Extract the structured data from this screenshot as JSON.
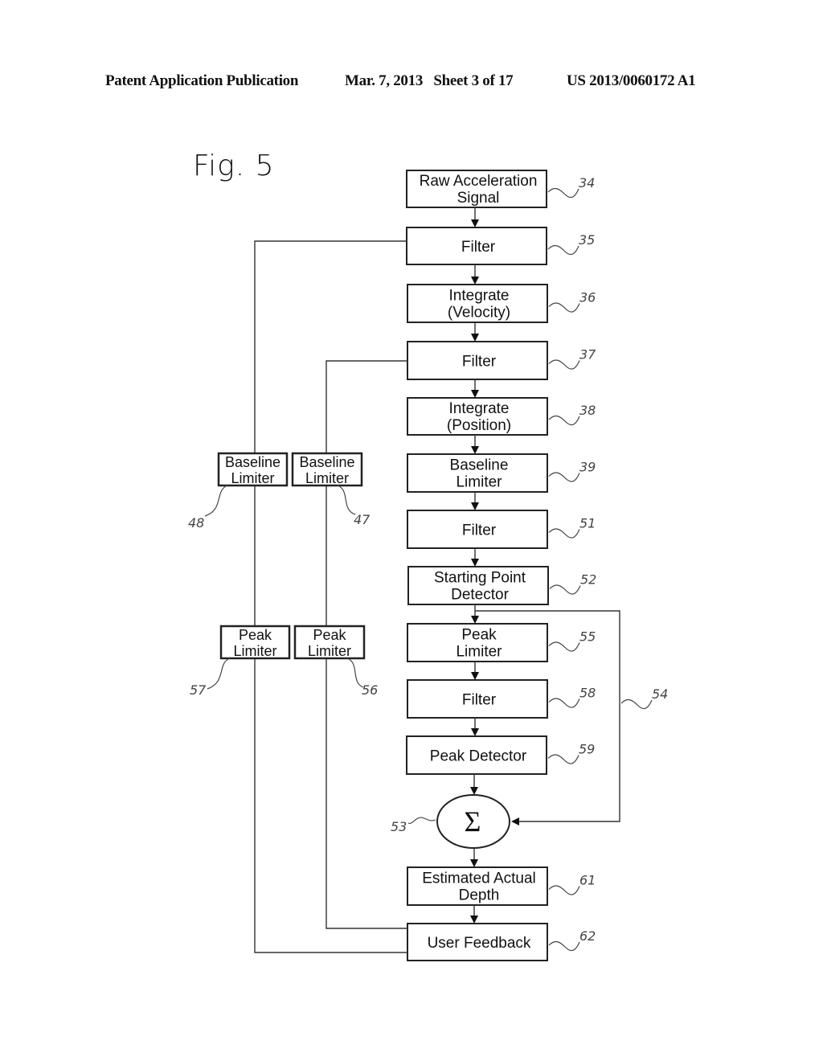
{
  "header": {
    "publication": "Patent Application Publication",
    "date_sheet": "Mar. 7, 2013   Sheet 3 of 17",
    "number": "US 2013/0060172 A1"
  },
  "figure": {
    "title": "Fig. 5",
    "main_blocks": [
      {
        "ref": "34",
        "lines": [
          "Raw Acceleration",
          "Signal"
        ]
      },
      {
        "ref": "35",
        "lines": [
          "Filter"
        ]
      },
      {
        "ref": "36",
        "lines": [
          "Integrate",
          "(Velocity)"
        ]
      },
      {
        "ref": "37",
        "lines": [
          "Filter"
        ]
      },
      {
        "ref": "38",
        "lines": [
          "Integrate",
          "(Position)"
        ]
      },
      {
        "ref": "39",
        "lines": [
          "Baseline",
          "Limiter"
        ]
      },
      {
        "ref": "51",
        "lines": [
          "Filter"
        ]
      },
      {
        "ref": "52",
        "lines": [
          "Starting Point",
          "Detector"
        ]
      },
      {
        "ref": "55",
        "lines": [
          "Peak",
          "Limiter"
        ]
      },
      {
        "ref": "58",
        "lines": [
          "Filter"
        ]
      },
      {
        "ref": "59",
        "lines": [
          "Peak Detector"
        ]
      },
      {
        "ref": "61",
        "lines": [
          "Estimated Actual",
          "Depth"
        ]
      },
      {
        "ref": "62",
        "lines": [
          "User Feedback"
        ]
      }
    ],
    "summer": {
      "ref": "53",
      "symbol": "Σ"
    },
    "bypass_ref": "54",
    "side_blocks": [
      {
        "ref": "48",
        "lines": [
          "Baseline",
          "Limiter"
        ]
      },
      {
        "ref": "47",
        "lines": [
          "Baseline",
          "Limiter"
        ]
      },
      {
        "ref": "57",
        "lines": [
          "Peak",
          "Limiter"
        ]
      },
      {
        "ref": "56",
        "lines": [
          "Peak",
          "Limiter"
        ]
      }
    ]
  }
}
